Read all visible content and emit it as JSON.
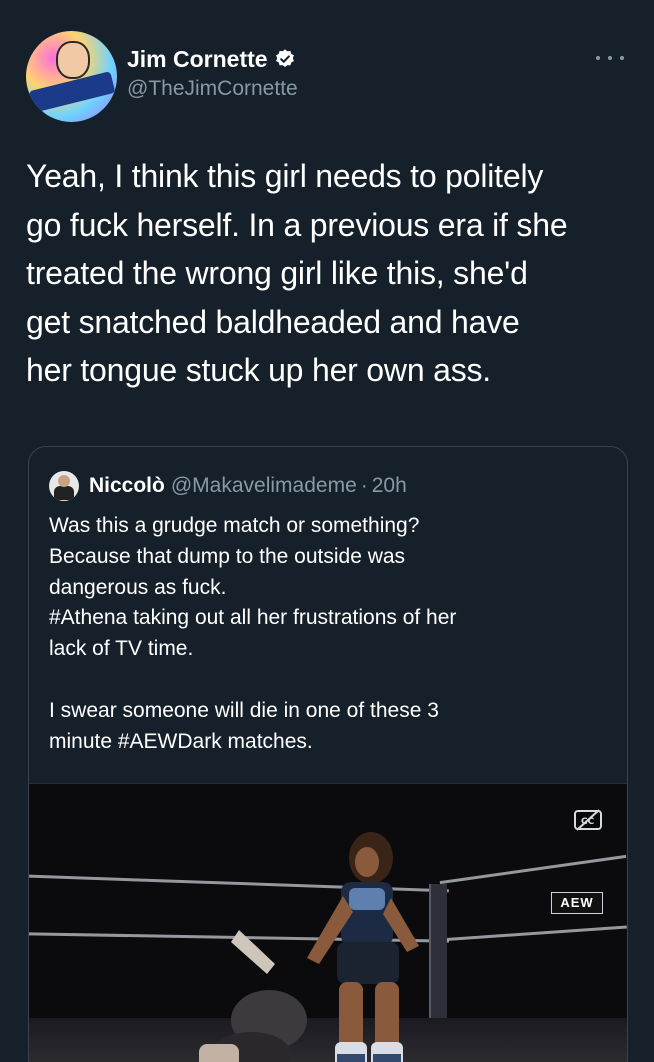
{
  "author": {
    "display_name": "Jim Cornette",
    "handle": "@TheJimCornette",
    "verified": true,
    "avatar_icon": "avatar-icon"
  },
  "tweet": {
    "text": "Yeah, I think this girl needs to politely\ngo fuck herself. In a previous era if she\ntreated the wrong girl like this, she'd\nget snatched baldheaded and have\nher tongue stuck up her own ass."
  },
  "quoted_tweet": {
    "display_name": "Niccolò",
    "handle": "@Makavelimademe",
    "separator": "·",
    "time": "20h",
    "text": "Was this a grudge match or something?\nBecause that dump to the outside was\ndangerous as fuck.\n#Athena taking out all her frustrations of her\nlack of TV time.\n\nI swear someone will die in one of these 3\nminute #AEWDark matches.",
    "media": {
      "type": "video",
      "caption_icon": "closed-captions-off-icon",
      "watermark": "AEW"
    }
  },
  "colors": {
    "background": "#15202b",
    "text_primary": "#ffffff",
    "text_secondary": "#8899a6",
    "border": "#38444d",
    "verified": "#ffffff"
  }
}
